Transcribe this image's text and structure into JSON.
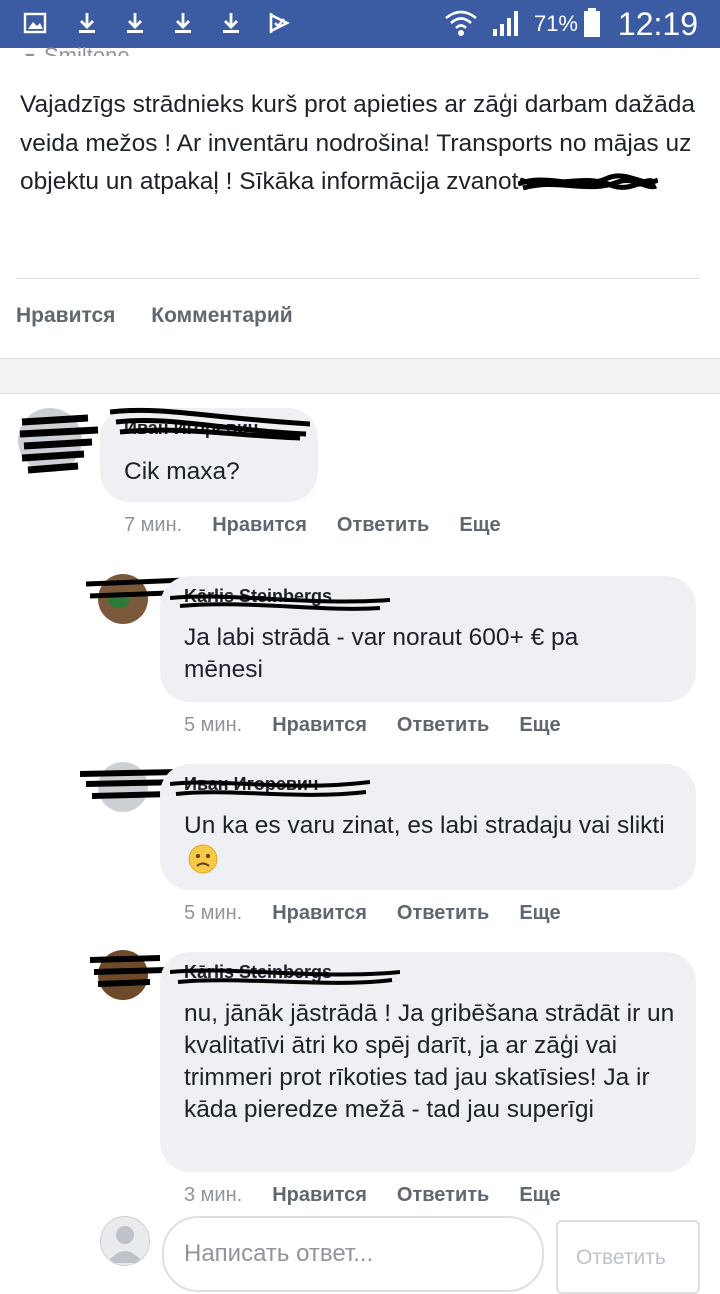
{
  "status_bar": {
    "battery_percent": "71%",
    "time": "12:19",
    "icons": [
      "gallery-icon",
      "download-icon",
      "download-icon",
      "download-icon",
      "download-icon",
      "check-flag-icon",
      "wifi-icon",
      "signal-icon",
      "battery-icon"
    ]
  },
  "post": {
    "place": "Smiltene",
    "text": "Vajadzīgs strādnieks kurš prot apieties ar zāģi darbam dažāda veida mežos ! Ar inventāru nodrošina! Transports no mājas uz objektu un atpakaļ ! Sīkāka informācija zvanot",
    "like_label": "Нравится",
    "comment_label": "Комментарий"
  },
  "comments": [
    {
      "author": "Иван Игоревич",
      "text": "Cik maxa?",
      "time": "7 мин.",
      "like": "Нравится",
      "reply": "Ответить",
      "more": "Еще"
    }
  ],
  "replies": [
    {
      "author": "Kārlis Steinbergs",
      "text": "Ja labi strādā - var noraut 600+ € pa mēnesi",
      "time": "5 мин.",
      "like": "Нравится",
      "reply": "Ответить",
      "more": "Еще"
    },
    {
      "author": "Иван Игоревич",
      "text": "Un ka es varu zinat, es labi stradaju vai slikti",
      "emoji": "worried-face-icon",
      "time": "5 мин.",
      "like": "Нравится",
      "reply": "Ответить",
      "more": "Еще"
    },
    {
      "author": "Kārlis Steinbergs",
      "text": "nu, jānāk jāstrādā ! Ja gribēšana strādāt ir un kvalitatīvi ātri ko spēj darīt, ja ar zāģi vai trimmeri prot rīkoties tad jau skatīsies! Ja ir kāda pieredze mežā - tad jau superīgi",
      "time": "3 мин.",
      "like": "Нравится",
      "reply": "Ответить",
      "more": "Еще"
    }
  ],
  "reply_box": {
    "placeholder": "Написать ответ...",
    "button": "Ответить"
  },
  "colors": {
    "status_bar": "#3b5ba3",
    "bubble": "#eef0f3",
    "meta": "#90949c"
  }
}
